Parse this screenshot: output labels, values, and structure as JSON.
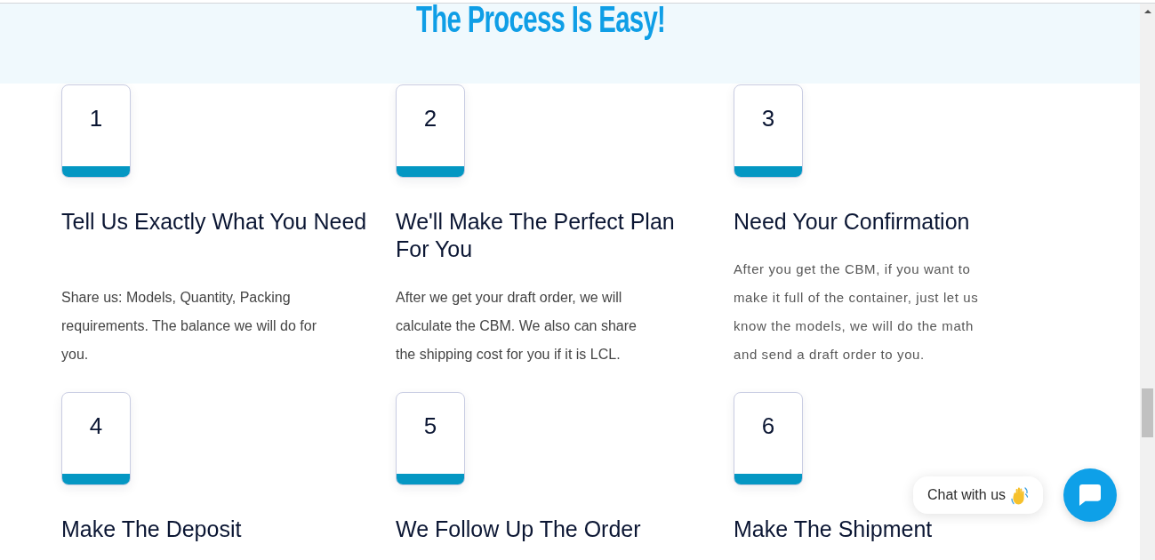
{
  "section": {
    "title": "The Process Is Easy!"
  },
  "steps": [
    {
      "number": "1",
      "title": "Tell Us Exactly What You Need",
      "description": "Share us: Models, Quantity, Packing requirements. The balance we will do for you."
    },
    {
      "number": "2",
      "title": "We'll Make The Perfect Plan For You",
      "description": "After we get your draft order, we will calculate the CBM. We also can share the shipping cost for you if it is LCL."
    },
    {
      "number": "3",
      "title": "Need Your Confirmation",
      "description": "After you get the CBM, if you want to make it full of the container, just let us know the models, we will do the math and send a draft order to you."
    },
    {
      "number": "4",
      "title": "Make The Deposit"
    },
    {
      "number": "5",
      "title": "We Follow Up The Order"
    },
    {
      "number": "6",
      "title": "Make The Shipment"
    }
  ],
  "chat_widget": {
    "prompt": "Chat with us"
  }
}
